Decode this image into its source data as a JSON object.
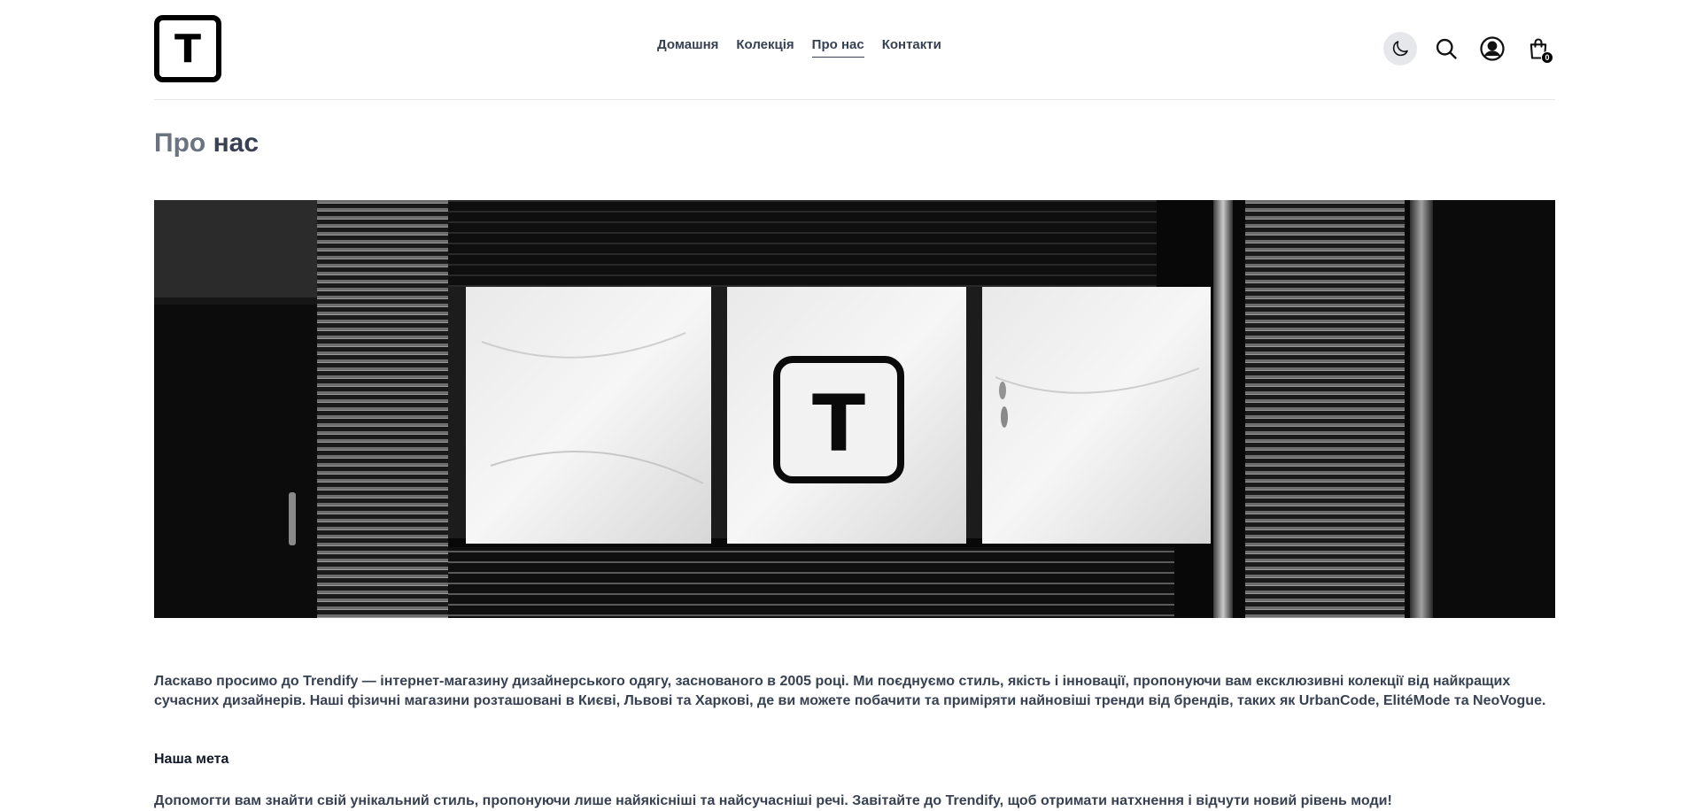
{
  "brand": {
    "logo_letter": "T"
  },
  "nav": {
    "items": [
      {
        "label": "Домашня",
        "active": false
      },
      {
        "label": "Колекція",
        "active": false
      },
      {
        "label": "Про нас",
        "active": true
      },
      {
        "label": "Контакти",
        "active": false
      }
    ]
  },
  "header_actions": {
    "theme_icon": "moon-icon",
    "search_icon": "search-icon",
    "account_icon": "user-icon",
    "cart_icon": "shopping-bag-icon",
    "cart_count": "0"
  },
  "page": {
    "title_part1": "Про",
    "title_part2": "нас"
  },
  "hero": {
    "sign_letter": "T"
  },
  "content": {
    "intro": "Ласкаво просимо до Trendify — інтернет-магазину дизайнерського одягу, заснованого в 2005 році. Ми поєднуємо стиль, якість і інновації, пропонуючи вам ексклюзивні колекції від найкращих сучасних дизайнерів. Наші фізичні магазини розташовані в Києві, Львові та Харкові, де ви можете побачити та приміряти найновіші тренди від брендів, таких як UrbanCode, ElitéMode та NeoVogue.",
    "goal_title": "Наша мета",
    "goal_text": "Допомогти вам знайти свій унікальний стиль, пропонуючи лише найякісніші та найсучасніші речі. Завітайте до Trendify, щоб отримати натхнення і відчути новий рівень моди!"
  },
  "colors": {
    "accent": "#000000",
    "text": "#374151",
    "muted": "#6b7280",
    "border": "#e5e7eb"
  }
}
